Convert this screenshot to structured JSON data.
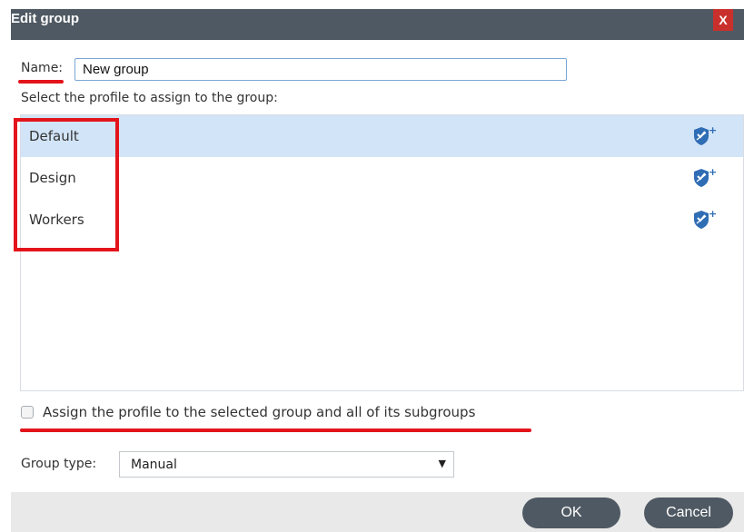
{
  "dialog": {
    "title": "Edit group",
    "close_label": "X"
  },
  "name": {
    "label": "Name:",
    "value": "New group"
  },
  "profiles": {
    "prompt": "Select the profile to assign to the group:",
    "items": [
      {
        "label": "Default",
        "selected": true,
        "icon": "shield-plus-icon"
      },
      {
        "label": "Design",
        "selected": false,
        "icon": "shield-plus-icon"
      },
      {
        "label": "Workers",
        "selected": false,
        "icon": "shield-plus-icon"
      }
    ]
  },
  "assign_subgroups": {
    "label": "Assign the profile to the selected group and all of its subgroups",
    "checked": false
  },
  "group_type": {
    "label": "Group type:",
    "selected": "Manual"
  },
  "buttons": {
    "ok": "OK",
    "cancel": "Cancel"
  },
  "colors": {
    "title_bar": "#4f5963",
    "close_button": "#c9302c",
    "selection": "#d2e4f7",
    "annotation": "#e3141b",
    "shield_icon": "#2f6db5"
  }
}
